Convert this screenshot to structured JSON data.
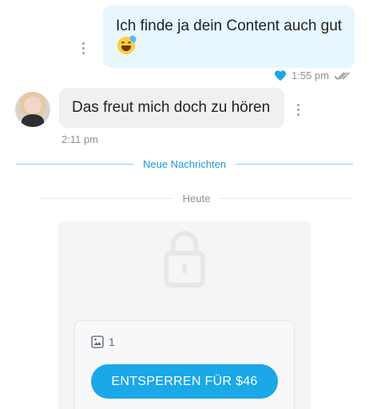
{
  "messages": {
    "outgoing": {
      "text": "Ich finde ja dein Content auch gut",
      "emoji": "grinning-face-with-sweat",
      "time": "1:55 pm",
      "liked": true,
      "status": "read"
    },
    "incoming": {
      "text": "Das freut mich doch zu hören",
      "time": "2:11 pm"
    }
  },
  "dividers": {
    "new_messages": "Neue Nachrichten",
    "today": "Heute"
  },
  "locked_post": {
    "media_count": "1",
    "media_icon": "image-icon",
    "unlock_label": "ENTSPERREN FÜR $46"
  },
  "colors": {
    "accent": "#1aa8e8",
    "outgoing_bubble": "#e8f6fd",
    "incoming_bubble": "#eef0f2"
  }
}
